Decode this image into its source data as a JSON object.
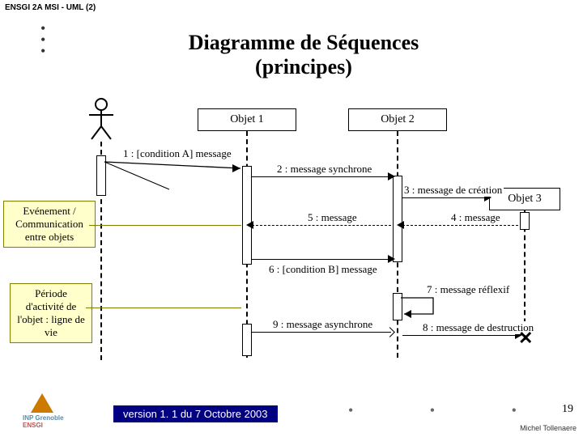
{
  "course_tag": "ENSGI 2A MSI - UML (2)",
  "title": "Diagramme de Séquences (principes)",
  "objects": {
    "obj1": "Objet 1",
    "obj2": "Objet 2",
    "obj3": "Objet 3"
  },
  "messages": {
    "m1": "1 : [condition A] message",
    "m2": "2 : message synchrone",
    "m3": "3 : message de création",
    "m4": "4 : message",
    "m5": "5 : message",
    "m6": "6 : [condition B] message",
    "m7": "7 : message réflexif",
    "m8": "8 : message de destruction",
    "m9": "9 : message asynchrone"
  },
  "notes": {
    "event": "Evénement / Communication entre objets",
    "period": "Période d'activité de l'objet : ligne de vie"
  },
  "footer": {
    "version": "version 1. 1 du 7 Octobre 2003",
    "author": "Michel Tollenaere",
    "page": "19",
    "logo_line1": "INP Grenoble",
    "logo_line2": "ENSGI"
  }
}
